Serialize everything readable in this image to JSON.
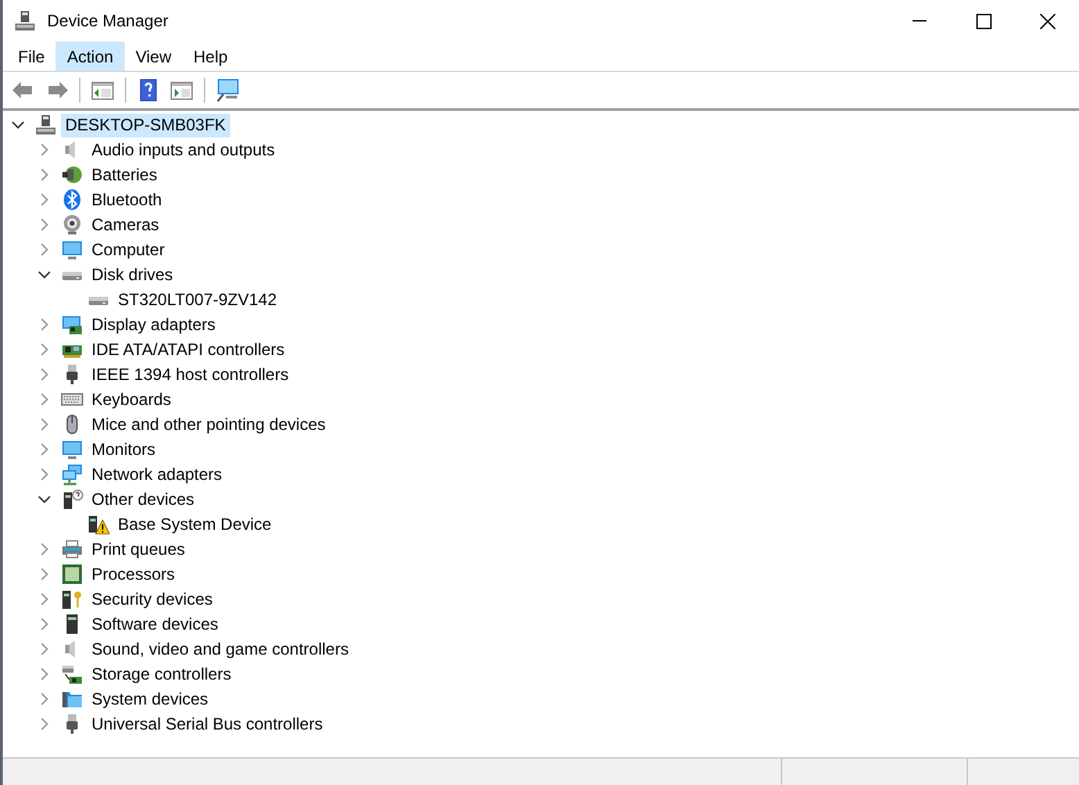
{
  "window": {
    "title": "Device Manager"
  },
  "menu": [
    {
      "label": "File",
      "selected": false
    },
    {
      "label": "Action",
      "selected": true
    },
    {
      "label": "View",
      "selected": false
    },
    {
      "label": "Help",
      "selected": false
    }
  ],
  "toolbar": [
    {
      "kind": "back",
      "disabled": true
    },
    {
      "kind": "forward",
      "disabled": true
    },
    {
      "kind": "separator"
    },
    {
      "kind": "panel",
      "disabled": false
    },
    {
      "kind": "separator"
    },
    {
      "kind": "help",
      "disabled": false
    },
    {
      "kind": "panel-play",
      "disabled": false
    },
    {
      "kind": "separator"
    },
    {
      "kind": "scan",
      "disabled": false
    }
  ],
  "tree": [
    {
      "label": "DESKTOP-SMB03FK",
      "kind": "computer",
      "expanded": true,
      "selected": true,
      "children": [
        {
          "label": "Audio inputs and outputs",
          "kind": "speaker",
          "expanded": false,
          "selected": false
        },
        {
          "label": "Batteries",
          "kind": "battery",
          "expanded": false,
          "selected": false
        },
        {
          "label": "Bluetooth",
          "kind": "bluetooth",
          "expanded": false,
          "selected": false
        },
        {
          "label": "Cameras",
          "kind": "camera",
          "expanded": false,
          "selected": false
        },
        {
          "label": "Computer",
          "kind": "monitor",
          "expanded": false,
          "selected": false
        },
        {
          "label": "Disk drives",
          "kind": "drive",
          "expanded": true,
          "selected": false,
          "children": [
            {
              "label": "ST320LT007-9ZV142",
              "kind": "drive",
              "selected": false
            }
          ]
        },
        {
          "label": "Display adapters",
          "kind": "display-card",
          "expanded": false,
          "selected": false
        },
        {
          "label": "IDE ATA/ATAPI controllers",
          "kind": "card",
          "expanded": false,
          "selected": false
        },
        {
          "label": "IEEE 1394 host controllers",
          "kind": "plug",
          "expanded": false,
          "selected": false
        },
        {
          "label": "Keyboards",
          "kind": "keyboard",
          "expanded": false,
          "selected": false
        },
        {
          "label": "Mice and other pointing devices",
          "kind": "mouse",
          "expanded": false,
          "selected": false
        },
        {
          "label": "Monitors",
          "kind": "monitor",
          "expanded": false,
          "selected": false
        },
        {
          "label": "Network adapters",
          "kind": "network",
          "expanded": false,
          "selected": false
        },
        {
          "label": "Other devices",
          "kind": "unknown",
          "expanded": true,
          "selected": false,
          "children": [
            {
              "label": "Base System Device",
              "kind": "warning",
              "selected": false
            }
          ]
        },
        {
          "label": "Print queues",
          "kind": "printer",
          "expanded": false,
          "selected": false
        },
        {
          "label": "Processors",
          "kind": "chip",
          "expanded": false,
          "selected": false
        },
        {
          "label": "Security devices",
          "kind": "security",
          "expanded": false,
          "selected": false
        },
        {
          "label": "Software devices",
          "kind": "tower",
          "expanded": false,
          "selected": false
        },
        {
          "label": "Sound, video and game controllers",
          "kind": "speaker",
          "expanded": false,
          "selected": false
        },
        {
          "label": "Storage controllers",
          "kind": "storage",
          "expanded": false,
          "selected": false
        },
        {
          "label": "System devices",
          "kind": "folder",
          "expanded": false,
          "selected": false
        },
        {
          "label": "Universal Serial Bus controllers",
          "kind": "usb",
          "expanded": false,
          "selected": false
        }
      ]
    }
  ]
}
